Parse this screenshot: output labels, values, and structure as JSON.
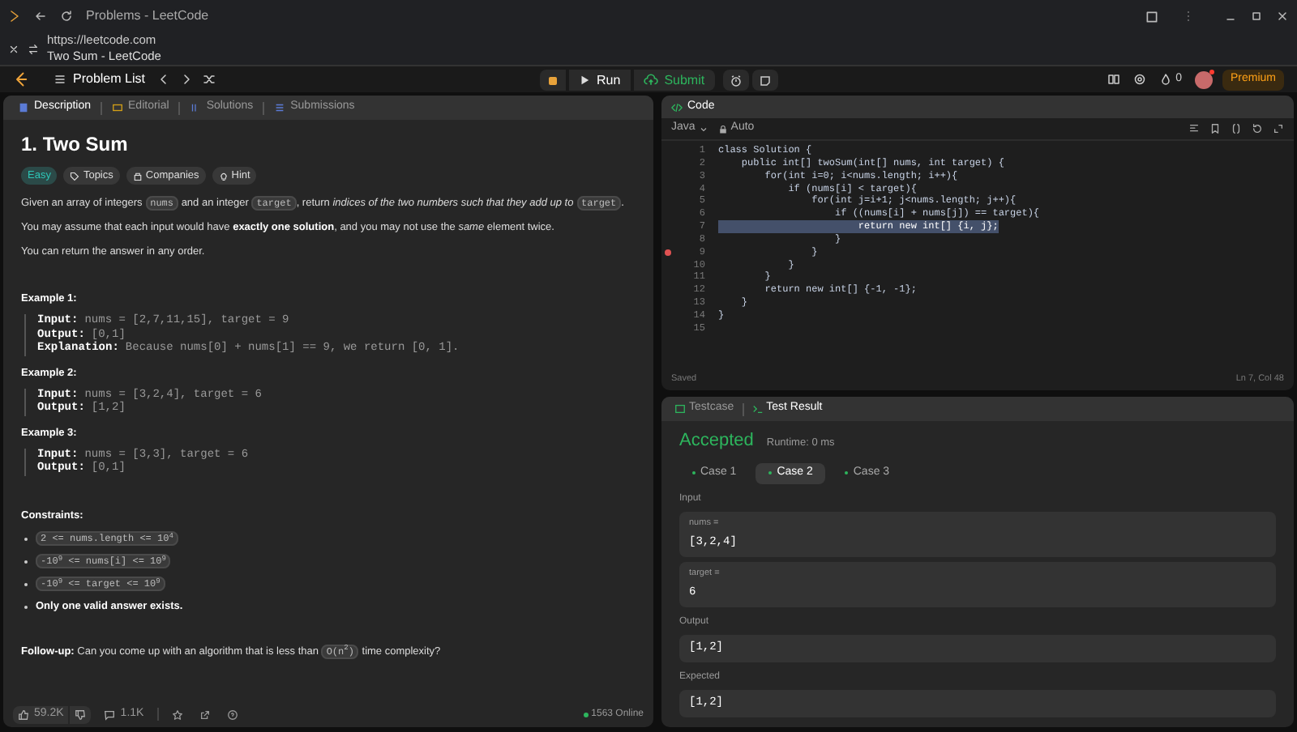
{
  "browser": {
    "tab_title": "Problems - LeetCode",
    "url": "https://leetcode.com",
    "page_title": "Two Sum - LeetCode"
  },
  "nav": {
    "problem_list": "Problem List",
    "run": "Run",
    "submit": "Submit",
    "streak": "0",
    "premium": "Premium"
  },
  "description": {
    "tabs": [
      {
        "label": "Description",
        "selected": true
      },
      {
        "label": "Editorial",
        "selected": false
      },
      {
        "label": "Solutions",
        "selected": false
      },
      {
        "label": "Submissions",
        "selected": false
      }
    ],
    "title": "1. Two Sum",
    "tags": [
      {
        "label": "Easy",
        "kind": "difficulty"
      },
      {
        "label": "Topics",
        "kind": "topics"
      },
      {
        "label": "Companies",
        "kind": "companies"
      },
      {
        "label": "Hint",
        "kind": "hint"
      }
    ],
    "paragraphs": [
      [
        {
          "kind": "text",
          "text": "Given an array of integers "
        },
        {
          "kind": "code",
          "text": "nums"
        },
        {
          "kind": "text",
          "text": " and an integer "
        },
        {
          "kind": "code",
          "text": "target"
        },
        {
          "kind": "text",
          "text": ", return "
        },
        {
          "kind": "italic",
          "text": "indices of the two numbers such that they add up to "
        },
        {
          "kind": "code",
          "text": "target"
        },
        {
          "kind": "text",
          "text": "."
        }
      ],
      [
        {
          "kind": "text",
          "text": "You may assume that each input would have "
        },
        {
          "kind": "bold",
          "text": "exactly one solution"
        },
        {
          "kind": "text",
          "text": ", and you may not use the "
        },
        {
          "kind": "italic",
          "text": "same"
        },
        {
          "kind": "text",
          "text": " element twice."
        }
      ],
      [
        {
          "kind": "text",
          "text": "You can return the answer in any order."
        }
      ]
    ],
    "examples": [
      {
        "title": "Example 1:",
        "lines": [
          {
            "label": "Input:",
            "value": "nums = [2,7,11,15], target = 9"
          },
          {
            "label": "Output:",
            "value": "[0,1]"
          },
          {
            "label": "Explanation:",
            "value": "Because nums[0] + nums[1] == 9, we return [0, 1]."
          }
        ]
      },
      {
        "title": "Example 2:",
        "lines": [
          {
            "label": "Input:",
            "value": "nums = [3,2,4], target = 6"
          },
          {
            "label": "Output:",
            "value": "[1,2]"
          }
        ]
      },
      {
        "title": "Example 3:",
        "lines": [
          {
            "label": "Input:",
            "value": "nums = [3,3], target = 6"
          },
          {
            "label": "Output:",
            "value": "[0,1]"
          }
        ]
      }
    ],
    "constraints_title": "Constraints:",
    "constraints": [
      {
        "kind": "code",
        "text": "2 <= nums.length <= 10$^{4}$"
      },
      {
        "kind": "code",
        "text": "-10$^{9}$ <= nums[i] <= 10$^{9}$"
      },
      {
        "kind": "code",
        "text": "-10$^{9}$ <= target <= 10$^{9}$"
      },
      {
        "kind": "bold",
        "text": "Only one valid answer exists."
      }
    ],
    "follow_up": [
      {
        "kind": "bold",
        "text": "Follow-up: "
      },
      {
        "kind": "text",
        "text": "Can you come up with an algorithm that is less than "
      },
      {
        "kind": "code",
        "text": "O(n$^{2}$)"
      },
      {
        "kind": "text",
        "text": " time complexity?"
      }
    ],
    "footer": {
      "likes": "59.2K",
      "comments": "1.1K",
      "online": "1563 Online"
    }
  },
  "editor": {
    "title": "Code",
    "language": "Java",
    "mode": "Auto",
    "lines": [
      {
        "number": "1",
        "text": "class Solution {",
        "highlighted": false,
        "breakpoint": false
      },
      {
        "number": "2",
        "text": "    public int[] twoSum(int[] nums, int target) {",
        "highlighted": false,
        "breakpoint": false
      },
      {
        "number": "3",
        "text": "        for(int i=0; i<nums.length; i++){",
        "highlighted": false,
        "breakpoint": false
      },
      {
        "number": "4",
        "text": "            if (nums[i] < target){",
        "highlighted": false,
        "breakpoint": false
      },
      {
        "number": "5",
        "text": "                for(int j=i+1; j<nums.length; j++){",
        "highlighted": false,
        "breakpoint": false
      },
      {
        "number": "6",
        "text": "                    if ((nums[i] + nums[j]) == target){",
        "highlighted": false,
        "breakpoint": false
      },
      {
        "number": "7",
        "text": "                        return new int[] {i, j};",
        "highlighted": true,
        "breakpoint": false
      },
      {
        "number": "8",
        "text": "                    }",
        "highlighted": false,
        "breakpoint": false
      },
      {
        "number": "9",
        "text": "                }",
        "highlighted": false,
        "breakpoint": true
      },
      {
        "number": "10",
        "text": "            }",
        "highlighted": false,
        "breakpoint": false
      },
      {
        "number": "11",
        "text": "        }",
        "highlighted": false,
        "breakpoint": false
      },
      {
        "number": "12",
        "text": "        return new int[] {-1, -1};",
        "highlighted": false,
        "breakpoint": false
      },
      {
        "number": "13",
        "text": "    }",
        "highlighted": false,
        "breakpoint": false
      },
      {
        "number": "14",
        "text": "}",
        "highlighted": false,
        "breakpoint": false
      },
      {
        "number": "15",
        "highlighted": false,
        "breakpoint": false
      }
    ],
    "status": "Saved",
    "cursor": "Ln 7, Col 48"
  },
  "result": {
    "tabs": [
      {
        "label": "Testcase",
        "selected": false
      },
      {
        "label": "Test Result",
        "selected": true
      }
    ],
    "verdict": "Accepted",
    "runtime": "Runtime: 0 ms",
    "cases": [
      {
        "label": "Case 1",
        "selected": false,
        "passed": true
      },
      {
        "label": "Case 2",
        "selected": true,
        "passed": true
      },
      {
        "label": "Case 3",
        "selected": false,
        "passed": true
      }
    ],
    "input_label": "Input",
    "inputs": [
      {
        "name": "nums =",
        "value": "[3,2,4]"
      },
      {
        "name": "target =",
        "value": "6"
      }
    ],
    "output_label": "Output",
    "output": "[1,2]",
    "expected_label": "Expected",
    "expected": "[1,2]"
  }
}
